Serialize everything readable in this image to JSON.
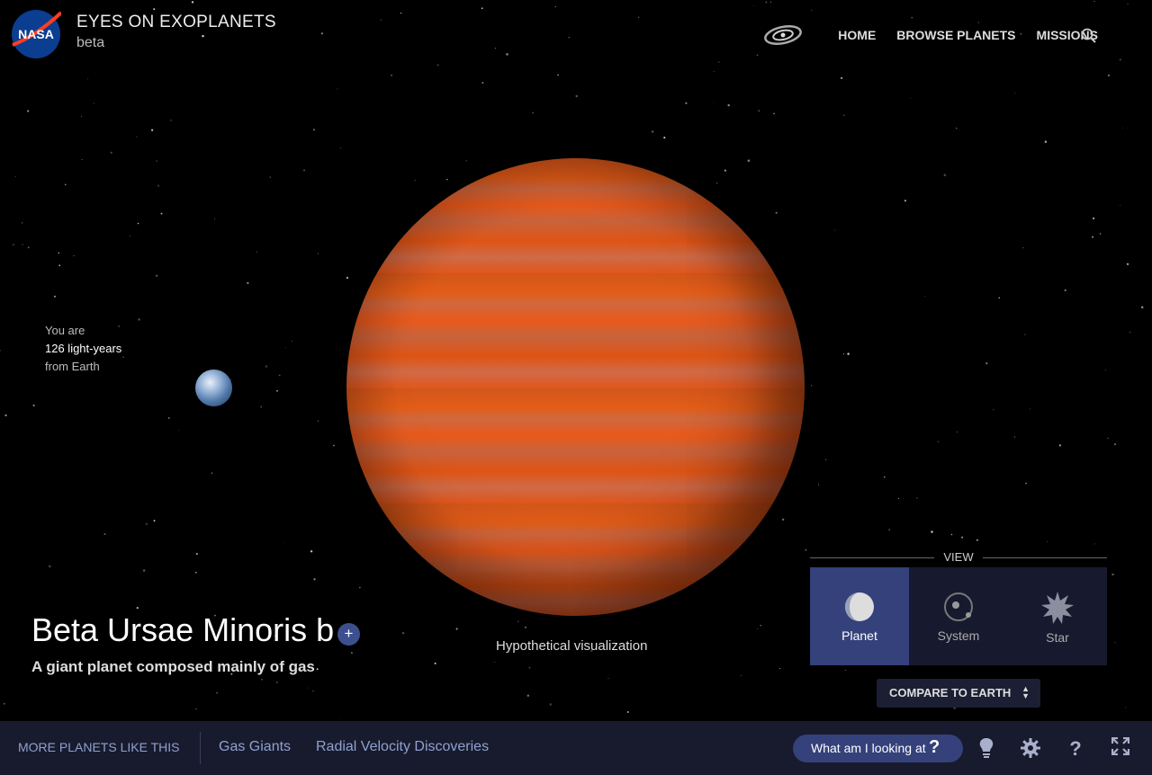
{
  "header": {
    "logo_text": "NASA",
    "title": "EYES ON EXOPLANETS",
    "subtitle": "beta",
    "nav": [
      {
        "label": "HOME",
        "icon": "galaxy-icon"
      },
      {
        "label": "BROWSE PLANETS"
      },
      {
        "label": "MISSIONS"
      }
    ]
  },
  "distance": {
    "line1": "You are",
    "value": "126 light-years",
    "line3": "from Earth"
  },
  "planet": {
    "name": "Beta Ursae Minoris b",
    "description": "A giant planet composed mainly of gas",
    "visualization_note": "Hypothetical visualization",
    "color": "#e35d18"
  },
  "view": {
    "label": "VIEW",
    "options": [
      {
        "label": "Planet",
        "active": true
      },
      {
        "label": "System",
        "active": false
      },
      {
        "label": "Star",
        "active": false
      }
    ],
    "compare_label": "COMPARE TO EARTH"
  },
  "bottom_bar": {
    "more_label": "MORE PLANETS LIKE THIS",
    "categories": [
      "Gas Giants",
      "Radial Velocity Discoveries"
    ],
    "what_label": "What am I looking at",
    "what_icon": "?"
  },
  "colors": {
    "accent": "#34417a",
    "link": "#8fa0d0",
    "bar_bg": "#181b2d"
  }
}
